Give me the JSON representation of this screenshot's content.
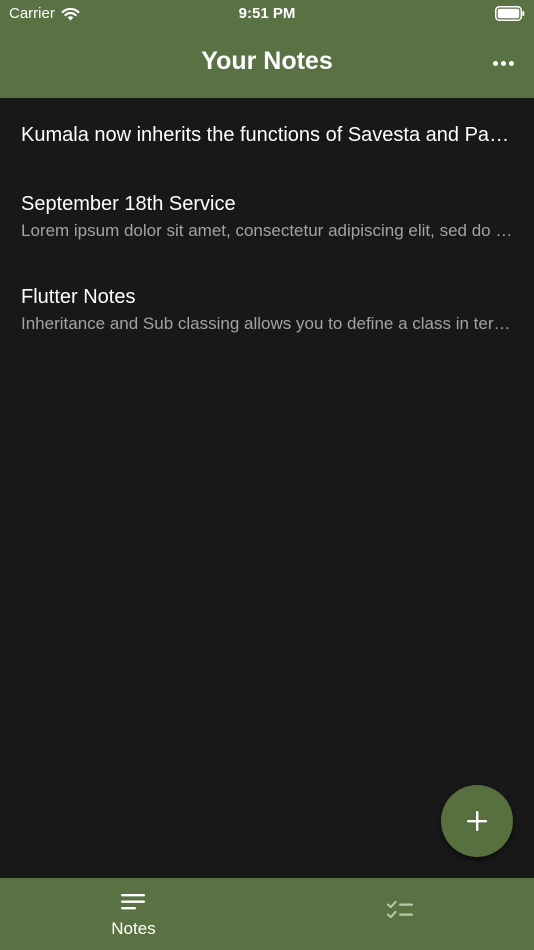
{
  "status_bar": {
    "carrier": "Carrier",
    "time": "9:51 PM",
    "wifi_icon": "wifi-icon",
    "battery_icon": "battery-icon"
  },
  "header": {
    "title": "Your Notes",
    "more_icon": "more-horizontal-icon",
    "color": "#5a7144"
  },
  "notes": [
    {
      "title": "Kumala now inherits the functions of  Savesta and Paparazzi",
      "preview": ""
    },
    {
      "title": "September 18th Service",
      "preview": "Lorem ipsum dolor sit amet, consectetur adipiscing elit, sed do eiusmod"
    },
    {
      "title": "Flutter Notes",
      "preview": "Inheritance and Sub classing allows you to define a class in terms of another"
    }
  ],
  "fab": {
    "icon": "plus-icon",
    "color": "#58703f"
  },
  "bottom_nav": {
    "tabs": [
      {
        "label": "Notes",
        "icon": "notes-lines-icon",
        "selected": true
      },
      {
        "label": "",
        "icon": "checklist-icon",
        "selected": false
      }
    ]
  },
  "colors": {
    "background": "#181818",
    "accent": "#5a7144",
    "muted_text": "#a3a3a3"
  }
}
